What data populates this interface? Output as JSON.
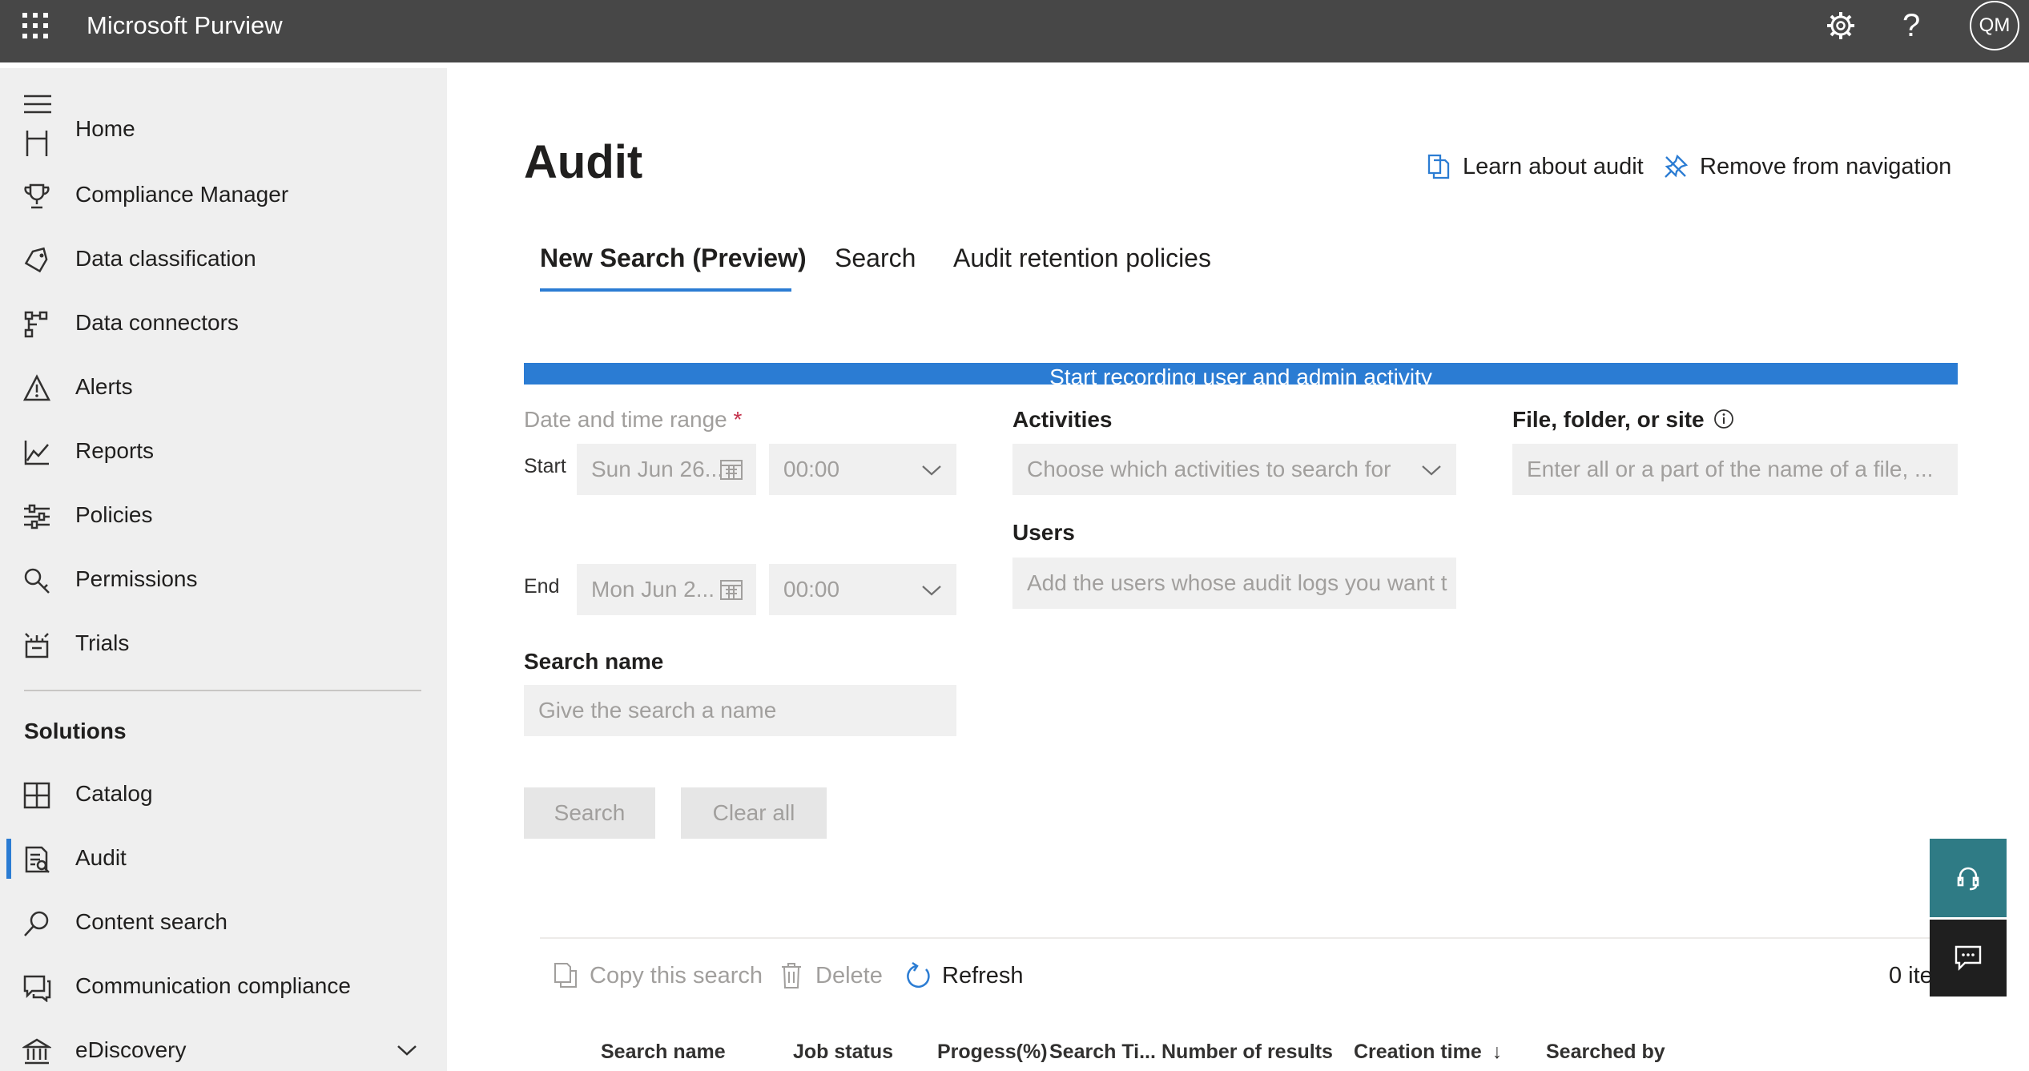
{
  "topbar": {
    "app_title": "Microsoft Purview",
    "waffle_icon": "app-launcher-icon",
    "settings_icon": "gear-icon",
    "help_label": "?",
    "avatar_initials": "QM"
  },
  "sidebar": {
    "items": [
      {
        "label": "Home",
        "icon": "home-icon"
      },
      {
        "label": "Compliance Manager",
        "icon": "trophy-icon"
      },
      {
        "label": "Data classification",
        "icon": "tag-icon"
      },
      {
        "label": "Data connectors",
        "icon": "connector-icon"
      },
      {
        "label": "Alerts",
        "icon": "warning-icon"
      },
      {
        "label": "Reports",
        "icon": "chart-icon"
      },
      {
        "label": "Policies",
        "icon": "sliders-icon"
      },
      {
        "label": "Permissions",
        "icon": "key-search-icon"
      },
      {
        "label": "Trials",
        "icon": "trial-icon"
      }
    ],
    "section_title": "Solutions",
    "solutions": [
      {
        "label": "Catalog",
        "icon": "catalog-icon"
      },
      {
        "label": "Audit",
        "icon": "audit-icon",
        "selected": true
      },
      {
        "label": "Content search",
        "icon": "search-icon"
      },
      {
        "label": "Communication compliance",
        "icon": "chat-icon"
      },
      {
        "label": "eDiscovery",
        "icon": "courthouse-icon"
      }
    ]
  },
  "page": {
    "title": "Audit",
    "learn_link": "Learn about audit",
    "remove_link": "Remove from navigation"
  },
  "tabs": [
    {
      "label": "New Search (Preview)",
      "active": true
    },
    {
      "label": "Search",
      "active": false
    },
    {
      "label": "Audit retention policies",
      "active": false
    }
  ],
  "banner": {
    "text": "Start recording user and admin activity"
  },
  "form": {
    "date_range_label": "Date and time range",
    "required_mark": "*",
    "start_label": "Start",
    "start_date": "Sun Jun 26...",
    "start_time": "00:00",
    "end_label": "End",
    "end_date": "Mon Jun 2...",
    "end_time": "00:00",
    "activities_label": "Activities",
    "activities_placeholder": "Choose which activities to search for",
    "users_label": "Users",
    "users_placeholder": "Add the users whose audit logs you want t",
    "file_label": "File, folder, or site",
    "file_placeholder": "Enter all or a part of the name of a file, ...",
    "search_name_label": "Search name",
    "search_name_placeholder": "Give the search a name",
    "search_button": "Search",
    "clear_button": "Clear all"
  },
  "commands": {
    "copy": "Copy this search",
    "delete": "Delete",
    "refresh": "Refresh",
    "item_count": "0 ite"
  },
  "table": {
    "headers": [
      "Search name",
      "Job status",
      "Progess(%)",
      "Search Ti...",
      "Number of results",
      "Creation time",
      "Searched by"
    ],
    "sort_indicator": "↓"
  },
  "colors": {
    "topbar": "#474747",
    "accent": "#2b7cd3",
    "sidebar": "#efefef",
    "fab_support": "#2f7b85",
    "fab_feedback": "#1f1f1f"
  }
}
